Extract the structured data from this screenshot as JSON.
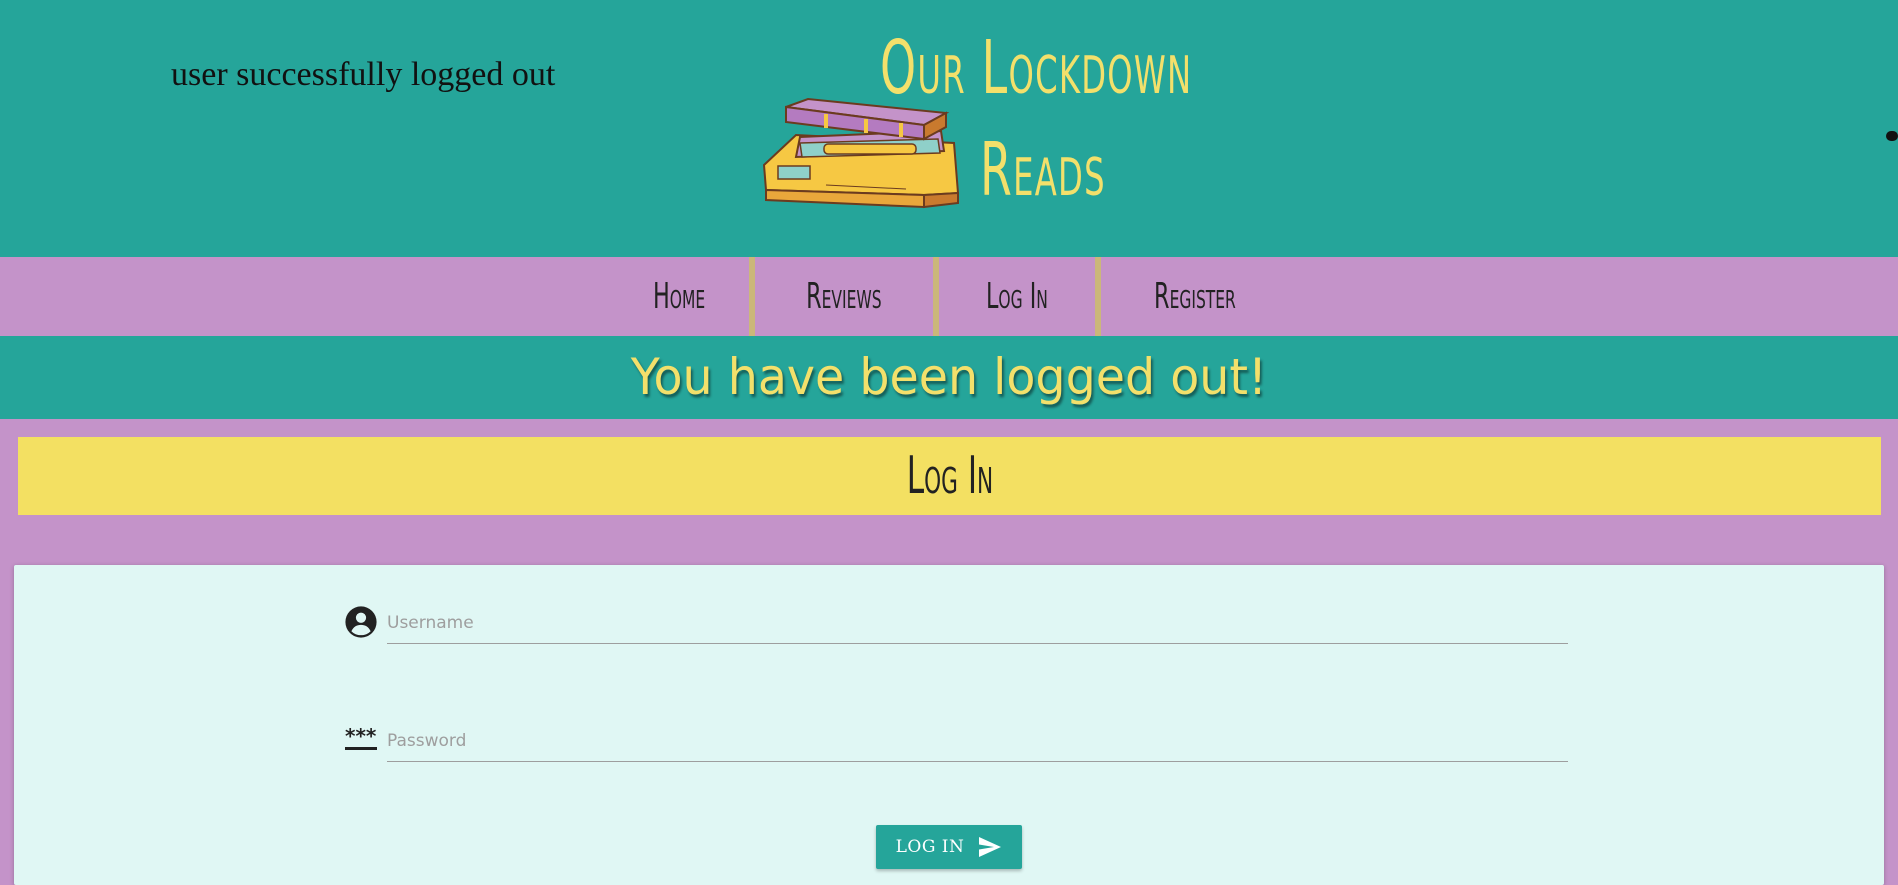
{
  "header": {
    "flash_message": "user successfully logged out",
    "brand_line1": "Our Lockdown",
    "brand_line2": "Reads"
  },
  "nav": {
    "items": [
      {
        "label": "Home"
      },
      {
        "label": "Reviews"
      },
      {
        "label": "Log In"
      },
      {
        "label": "Register"
      }
    ]
  },
  "banner": {
    "message": "You have been logged out!"
  },
  "page_title": "Log In",
  "form": {
    "username": {
      "placeholder": "Username",
      "value": "",
      "icon": "account-circle-icon"
    },
    "password": {
      "placeholder": "Password",
      "value": "",
      "icon": "password-icon"
    },
    "submit_label": "LOG IN",
    "submit_icon": "send-icon"
  },
  "colors": {
    "teal": "#25a59a",
    "purple": "#c493c9",
    "yellow": "#f3e062",
    "card": "#e0f7f4"
  }
}
